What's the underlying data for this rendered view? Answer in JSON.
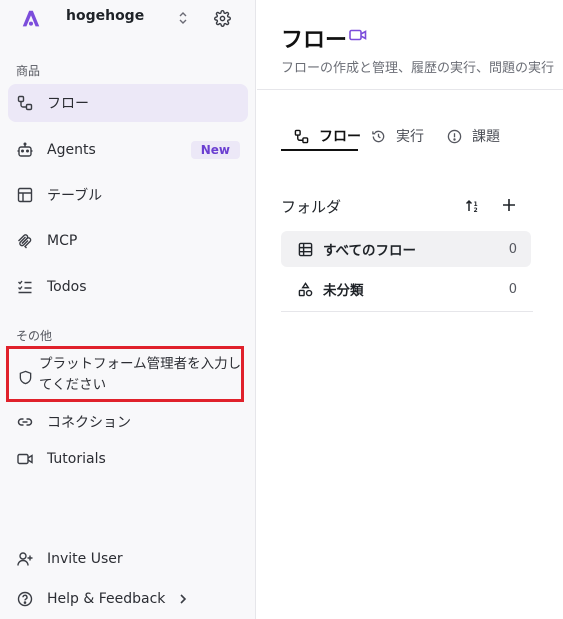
{
  "workspace": {
    "name": "hogehoge"
  },
  "sidebar": {
    "sections": {
      "products": "商品",
      "other": "その他"
    },
    "products_items": [
      {
        "label": "フロー",
        "icon": "flow-icon",
        "active": true
      },
      {
        "label": "Agents",
        "icon": "bot-icon",
        "badge": "New"
      },
      {
        "label": "テーブル",
        "icon": "table-icon"
      },
      {
        "label": "MCP",
        "icon": "mcp-icon"
      },
      {
        "label": "Todos",
        "icon": "todos-icon"
      }
    ],
    "other_items": [
      {
        "label": "プラットフォーム管理者を入力してください",
        "icon": "shield-icon"
      },
      {
        "label": "コネクション",
        "icon": "link-icon"
      },
      {
        "label": "Tutorials",
        "icon": "video-icon"
      }
    ],
    "footer_items": [
      {
        "label": "Invite User",
        "icon": "user-plus-icon"
      },
      {
        "label": "Help & Feedback",
        "icon": "help-icon"
      }
    ]
  },
  "main": {
    "title": "フロー",
    "subtitle": "フローの作成と管理、履歴の実行、問題の実行",
    "tabs": [
      {
        "label": "フロー",
        "icon": "flow-icon",
        "active": true
      },
      {
        "label": "実行",
        "icon": "history-icon"
      },
      {
        "label": "課題",
        "icon": "alert-icon"
      }
    ],
    "folders": {
      "title": "フォルダ",
      "rows": [
        {
          "label": "すべてのフロー",
          "count": "0",
          "icon": "table-icon",
          "selected": true
        },
        {
          "label": "未分類",
          "count": "0",
          "icon": "shapes-icon"
        }
      ]
    }
  },
  "colors": {
    "accent": "#6b3fd1",
    "active_bg": "#ece8f7",
    "highlight": "#e0212b"
  }
}
